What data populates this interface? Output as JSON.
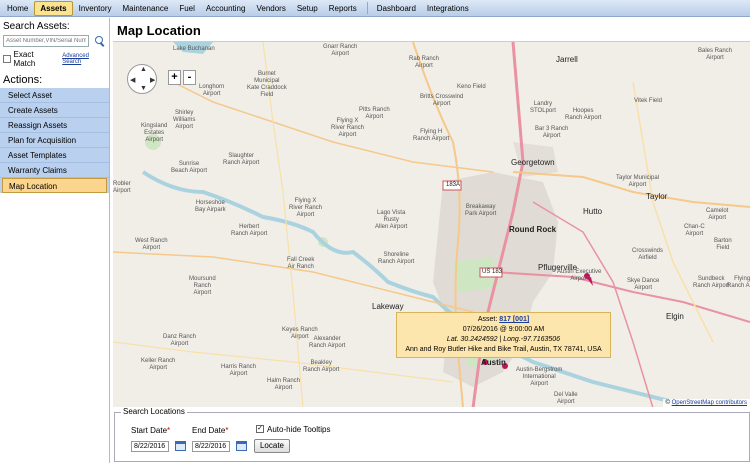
{
  "nav": {
    "items": [
      "Home",
      "Assets",
      "Inventory",
      "Maintenance",
      "Fuel",
      "Accounting",
      "Vendors",
      "Setup",
      "Reports",
      "Dashboard",
      "Integrations"
    ],
    "active": "Assets"
  },
  "sidebar": {
    "search_title": "Search Assets:",
    "search_placeholder": "Asset Number,VIN/Serial Number",
    "exact_match_label": "Exact Match",
    "advanced_search_label": "Advanced Search",
    "actions_title": "Actions:",
    "actions": [
      "Select Asset",
      "Create Assets",
      "Reassign Assets",
      "Plan for Acquisition",
      "Asset Templates",
      "Warranty Claims",
      "Map Location"
    ],
    "active_action": "Map Location"
  },
  "main": {
    "title": "Map Location"
  },
  "map": {
    "places": [
      {
        "name": "Lake Buchanan"
      },
      {
        "name": "Gnarr Ranch\nAirport"
      },
      {
        "name": "Jarrell"
      },
      {
        "name": "Bales Ranch\nAirport"
      },
      {
        "name": "Longhorn\nAirport"
      },
      {
        "name": "Burnet\nMunicipal\nKate Craddock\nField"
      },
      {
        "name": "Rab Ranch\nAirport"
      },
      {
        "name": "Britts Crosswind\nAirport"
      },
      {
        "name": "Keno Field"
      },
      {
        "name": "Landry\nSTOLport"
      },
      {
        "name": "Vitek Field"
      },
      {
        "name": "Kingsland\nEstates\nAirport"
      },
      {
        "name": "Shirley\nWilliams\nAirport"
      },
      {
        "name": "Pitts Ranch\nAirport"
      },
      {
        "name": "Hoopes\nRanch Airport"
      },
      {
        "name": "Bar 3 Ranch\nAirport"
      },
      {
        "name": "Flying X\nRiver Ranch\nAirport"
      },
      {
        "name": "Flying H\nRanch Airport"
      },
      {
        "name": "Slaughter\nRanch Airport"
      },
      {
        "name": "Sunrise\nBeach Airport"
      },
      {
        "name": "Georgetown"
      },
      {
        "name": "Taylor Municipal\nAirport"
      },
      {
        "name": "Taylor"
      },
      {
        "name": "Horseshoe\nBay Airpark"
      },
      {
        "name": "Breakaway\nPark Airport"
      },
      {
        "name": "Hutto"
      },
      {
        "name": "Camelot\nAirport"
      },
      {
        "name": "Flying X\nRiver Ranch\nAirport"
      },
      {
        "name": "Lago Vista\nRusty\nAllen Airport"
      },
      {
        "name": "Round Rock"
      },
      {
        "name": "Chan-C\nAirport"
      },
      {
        "name": "Herbert\nRanch Airport"
      },
      {
        "name": "Barton\nField"
      },
      {
        "name": "Pflugerville"
      },
      {
        "name": "Austin Executive\nAirport"
      },
      {
        "name": "West Ranch\nAirport"
      },
      {
        "name": "Fall Creek\nAir Ranch"
      },
      {
        "name": "Shoreline\nRanch Airport"
      },
      {
        "name": "Crosswinds\nAirfield"
      },
      {
        "name": "Sundbeck\nRanch Airport"
      },
      {
        "name": "Moursund\nRanch\nAirport"
      },
      {
        "name": "Skye Dance\nAirport"
      },
      {
        "name": "Lakeway"
      },
      {
        "name": "Elgin"
      },
      {
        "name": "Keyes Ranch\nAirport"
      },
      {
        "name": "Alexander\nRanch Airport"
      },
      {
        "name": "Danz Ranch\nAirport"
      },
      {
        "name": "Beakley\nRanch Airport"
      },
      {
        "name": "Keller Ranch\nAirport"
      },
      {
        "name": "Harris Ranch\nAirport"
      },
      {
        "name": "Halm Ranch\nAirport"
      },
      {
        "name": "Austin-Bergstrom\nInternational\nAirport"
      },
      {
        "name": "Del Valle\nAirport"
      },
      {
        "name": "Austin"
      },
      {
        "name": "Robler\nAirport"
      },
      {
        "name": "Flying R\nRanch Airport"
      }
    ],
    "road_shields": [
      "183A",
      "US 183"
    ],
    "zoom_in": "+",
    "zoom_out": "-",
    "tooltip": {
      "asset_label": "Asset:",
      "asset_link": "817 [001]",
      "datetime": "07/26/2016 @ 9:00:00 AM",
      "coords": "Lat. 30.2424592 | Long.-97.7163506",
      "address": "Ann and Roy Butler Hike and Bike Trail, Austin, TX 78741, USA"
    },
    "credit_prefix": "© ",
    "credit_link": "OpenStreetMap contributors"
  },
  "search_locations": {
    "legend": "Search Locations",
    "start_label": "Start Date",
    "end_label": "End Date",
    "required_mark": "*",
    "start_value": "8/22/2016",
    "end_value": "8/22/2016",
    "autohide_label": "Auto-hide Tooltips",
    "locate_label": "Locate"
  }
}
